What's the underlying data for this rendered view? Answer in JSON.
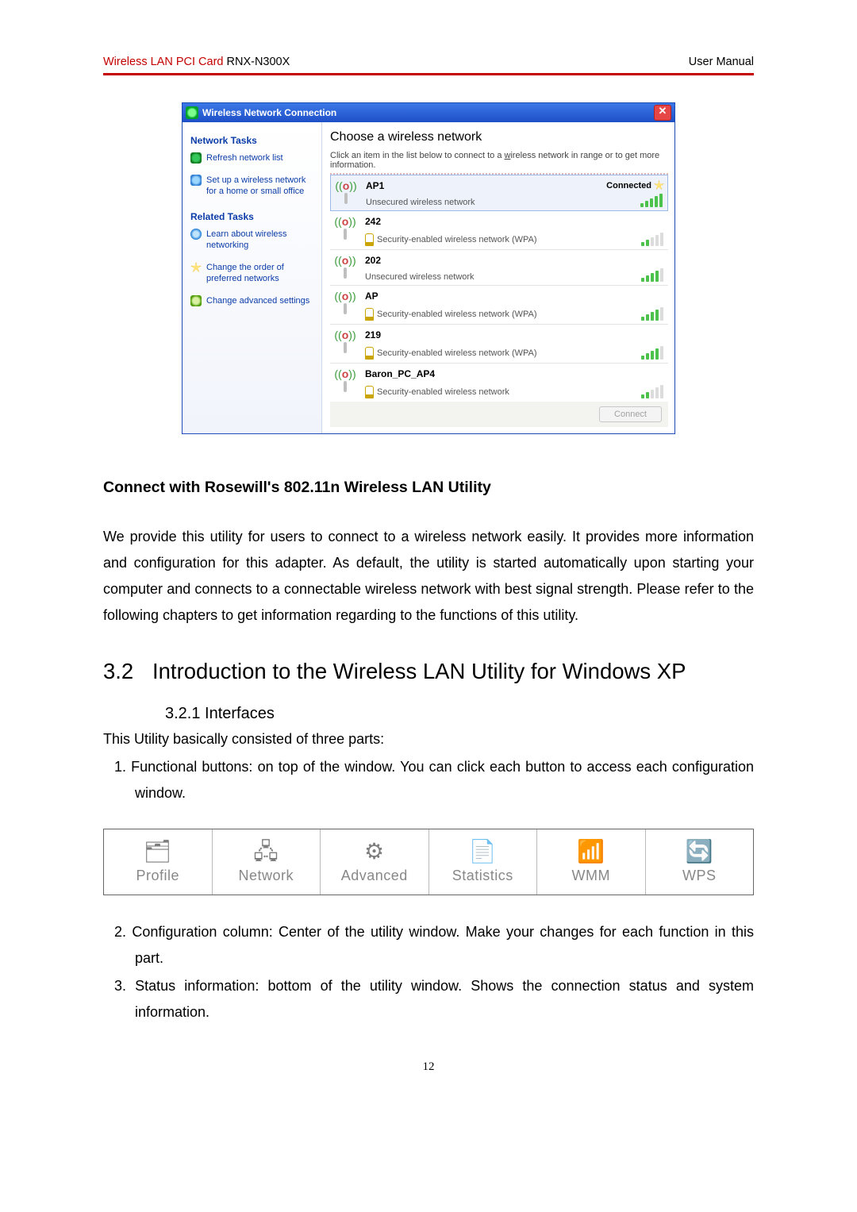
{
  "header": {
    "product_red": "Wireless LAN PCI Card",
    "model": " RNX-N300X",
    "right": "User Manual"
  },
  "dialog": {
    "title": "Wireless Network Connection",
    "sidebar": {
      "group1_title": "Network Tasks",
      "links1": [
        {
          "label": "Refresh network list"
        },
        {
          "label": "Set up a wireless network for a home or small office"
        }
      ],
      "group2_title": "Related Tasks",
      "links2": [
        {
          "label": "Learn about wireless networking"
        },
        {
          "label": "Change the order of preferred networks"
        },
        {
          "label": "Change advanced settings"
        }
      ]
    },
    "main": {
      "heading": "Choose a wireless network",
      "hint_a": "Click an item in the list below to connect to a ",
      "hint_u": "w",
      "hint_b": "ireless network in range or to get more information.",
      "connected_label": "Connected",
      "connect_btn": "Connect",
      "networks": [
        {
          "ssid": "AP1",
          "desc": "Unsecured wireless network",
          "secure": false,
          "signal": 5,
          "connected": true,
          "selected": true
        },
        {
          "ssid": "242",
          "desc": "Security-enabled wireless network (WPA)",
          "secure": true,
          "signal": 2
        },
        {
          "ssid": "202",
          "desc": "Unsecured wireless network",
          "secure": false,
          "signal": 4
        },
        {
          "ssid": "AP",
          "desc": "Security-enabled wireless network (WPA)",
          "secure": true,
          "signal": 4
        },
        {
          "ssid": "219",
          "desc": "Security-enabled wireless network (WPA)",
          "secure": true,
          "signal": 4
        },
        {
          "ssid": "Baron_PC_AP4",
          "desc": "Security-enabled wireless network",
          "secure": true,
          "signal": 2
        }
      ]
    }
  },
  "text": {
    "sec_title": "Connect with Rosewill's 802.11n Wireless LAN Utility",
    "p1": "We provide this utility for users to connect to a wireless network easily. It provides more information and configuration for this adapter. As default, the utility is started automatically upon starting your computer and connects to a connectable wireless network with best signal strength. Please refer to the following chapters to get information regarding to the functions of this utility.",
    "h2_num": "3.2",
    "h2": "Introduction to the Wireless LAN Utility for Windows XP",
    "h3": "3.2.1  Interfaces",
    "p2": "This Utility basically consisted of three parts:",
    "li1": "1.  Functional buttons: on top of the window. You can click each button to access each configuration window.",
    "li2": "2. Configuration column: Center of the utility window. Make your changes for each function in this part.",
    "li3": "3. Status information: bottom of the utility window. Shows the connection status and system information."
  },
  "toolbar": {
    "items": [
      {
        "label": "Profile",
        "glyph": "🗂"
      },
      {
        "label": "Network",
        "glyph": "🖧"
      },
      {
        "label": "Advanced",
        "glyph": "⚙"
      },
      {
        "label": "Statistics",
        "glyph": "📄"
      },
      {
        "label": "WMM",
        "glyph": "📶"
      },
      {
        "label": "WPS",
        "glyph": "🔄"
      }
    ]
  },
  "page_number": "12"
}
